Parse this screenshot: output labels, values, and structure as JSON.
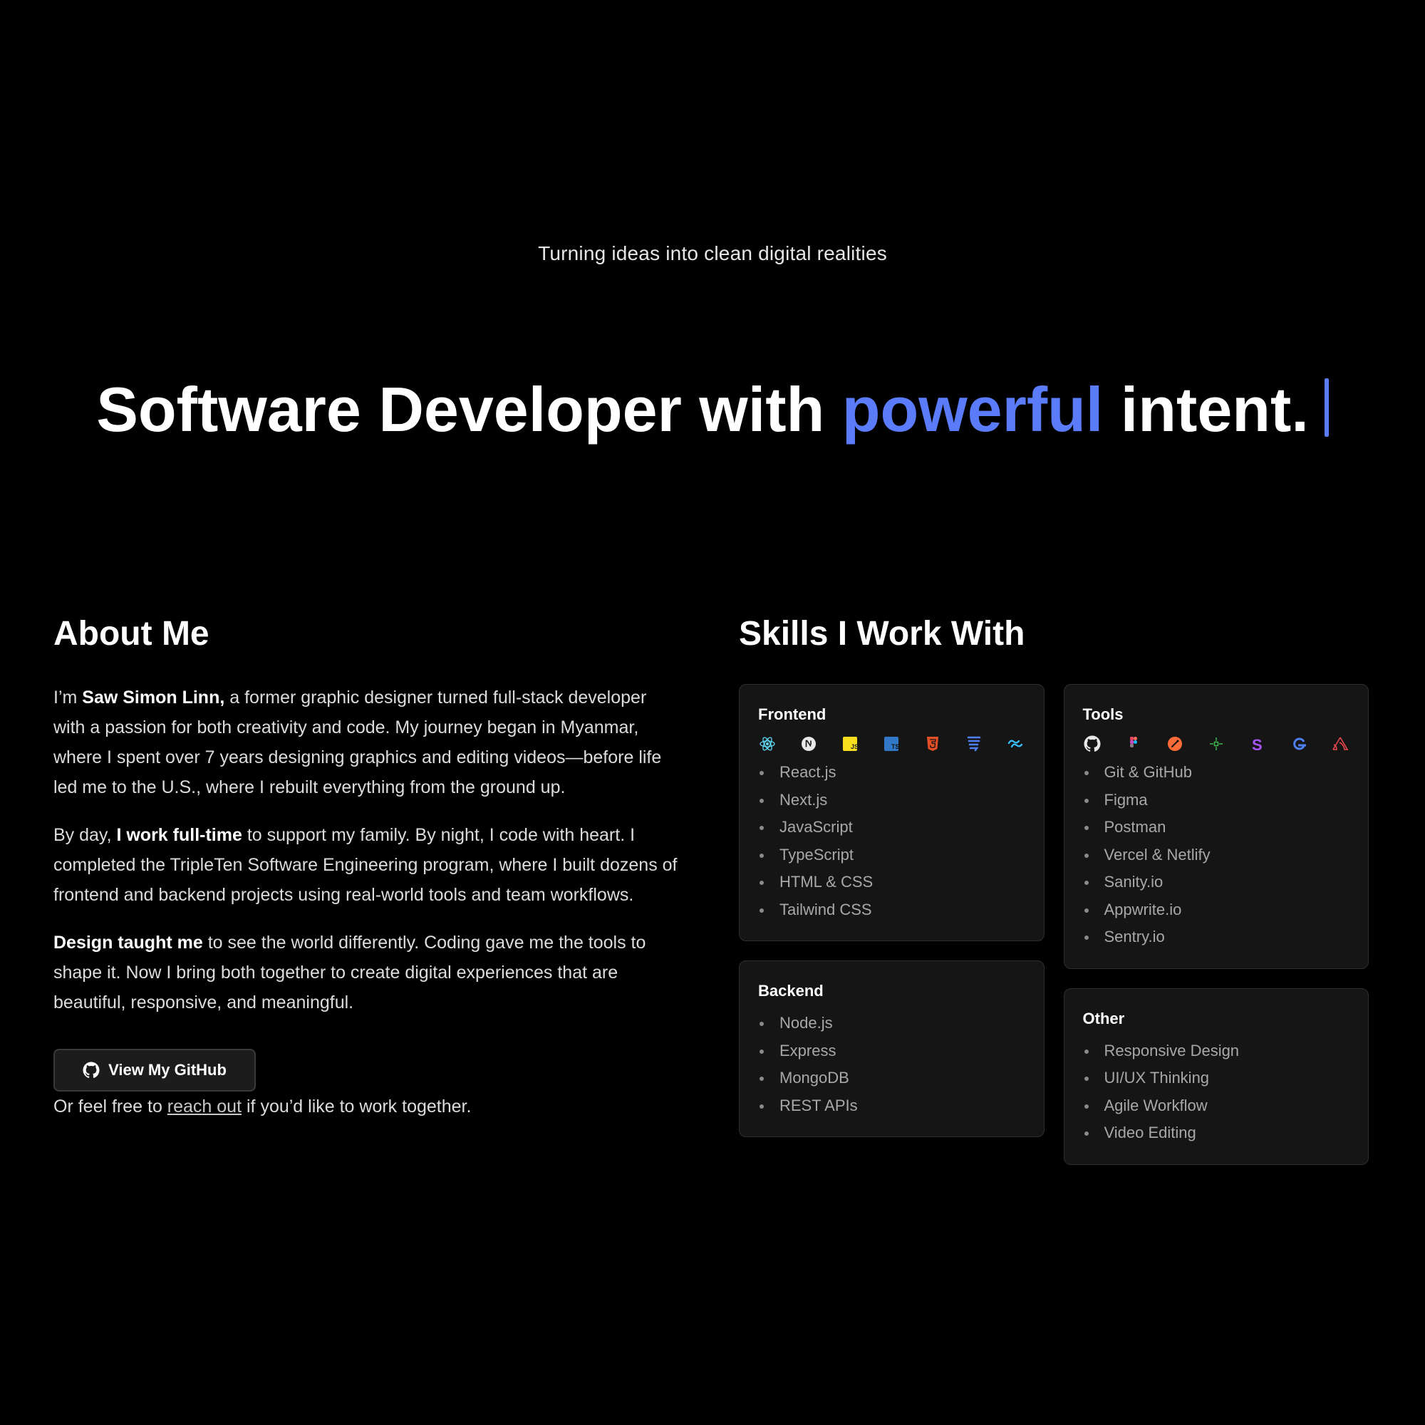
{
  "hero": {
    "tagline": "Turning ideas into clean digital realities",
    "title_part1": "Software Developer with ",
    "title_accent": "powerful",
    "title_part2": " intent.",
    "accent_color": "#5b7cfa"
  },
  "about": {
    "title": "About Me",
    "p1_a": "I’m ",
    "p1_b": "Saw Simon Linn,",
    "p1_c": " a former graphic designer turned full-stack developer with a passion for both creativity and code. My journey began in Myanmar, where I spent over 7 years designing graphics and editing videos—before life led me to the U.S., where I rebuilt everything from the ground up.",
    "p2_a": "By day, ",
    "p2_b": "I work full-time",
    "p2_c": " to support my family. By night, I code with heart. I completed the TripleTen Software Engineering program, where I built dozens of frontend and backend projects using real-world tools and team workflows.",
    "p3_a": "Design taught me",
    "p3_b": " to see the world differently. Coding gave me the tools to shape it. Now I bring both together to create digital experiences that are beautiful, responsive, and meaningful.",
    "github_button": "View My GitHub",
    "reach_a": "Or feel free to ",
    "reach_link": "reach out",
    "reach_b": " if you’d like to work together."
  },
  "skills": {
    "title": "Skills I Work With",
    "frontend": {
      "title": "Frontend",
      "icons": [
        "react-icon",
        "nextjs-icon",
        "javascript-icon",
        "typescript-icon",
        "html5-icon",
        "css3-icon",
        "tailwind-icon"
      ],
      "items": [
        "React.js",
        "Next.js",
        "JavaScript",
        "TypeScript",
        "HTML & CSS",
        "Tailwind CSS"
      ]
    },
    "backend": {
      "title": "Backend",
      "items": [
        "Node.js",
        "Express",
        "MongoDB",
        "REST APIs"
      ]
    },
    "tools": {
      "title": "Tools",
      "icons": [
        "github-icon",
        "figma-icon",
        "postman-icon",
        "netlify-icon",
        "sanity-icon",
        "appwrite-icon",
        "sentry-icon"
      ],
      "items": [
        "Git & GitHub",
        "Figma",
        "Postman",
        "Vercel & Netlify",
        "Sanity.io",
        "Appwrite.io",
        "Sentry.io"
      ]
    },
    "other": {
      "title": "Other",
      "items": [
        "Responsive Design",
        "UI/UX Thinking",
        "Agile Workflow",
        "Video Editing"
      ]
    }
  }
}
